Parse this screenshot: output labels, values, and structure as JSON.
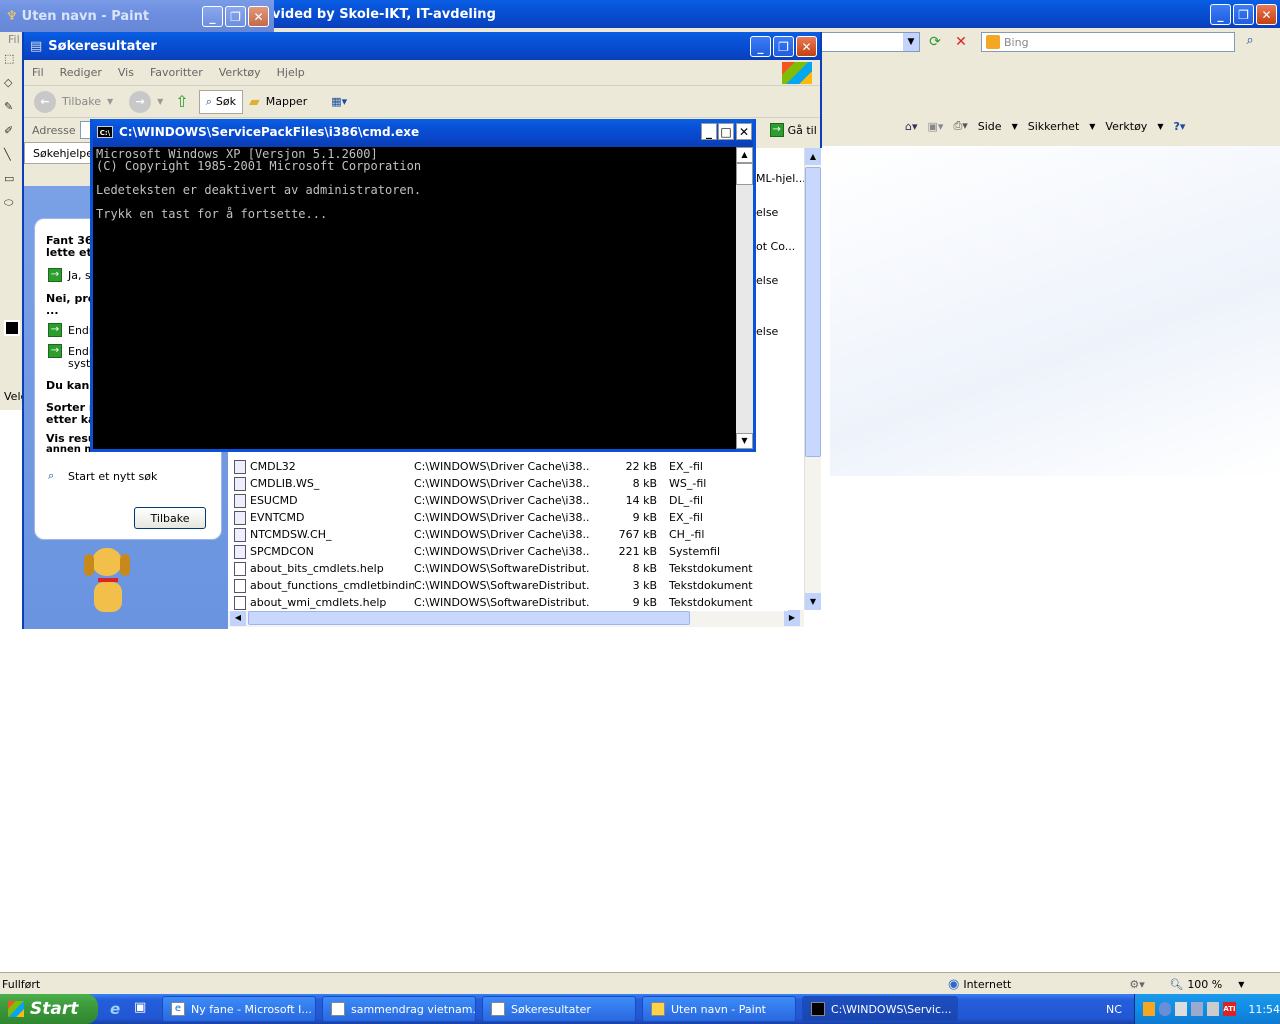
{
  "ie": {
    "title_suffix": "vided by Skole-IKT, IT-avdeling",
    "search_placeholder": "Bing",
    "toolbar": [
      "Side",
      "Sikkerhet",
      "Verktøy"
    ],
    "status_left": "Fullført",
    "status_zone": "Internett",
    "zoom": "100 %"
  },
  "paint": {
    "title": "Uten navn - Paint",
    "menu_fragment": "Fil",
    "status_fragment": "Velg"
  },
  "search": {
    "title": "Søkeresultater",
    "menu": [
      "Fil",
      "Rediger",
      "Vis",
      "Favoritter",
      "Verktøy",
      "Hjelp"
    ],
    "back": "Tilbake",
    "search": "Søk",
    "folders": "Mapper",
    "address_label": "Adresse",
    "go": "Gå til",
    "companion_tab": "Søkehjelper",
    "pane": {
      "found_1": "Fant 36",
      "found_2": "lette et",
      "yes": "Ja, s",
      "no": "Nei, pre",
      "dots": "...",
      "change1": "Endr",
      "change2a": "Endr",
      "change2b": "syst",
      "can": "Du kan",
      "sort_1": "Sorter r",
      "sort_2": "etter ka",
      "show_1": "Vis resu",
      "show_2": "annen måte",
      "new_search": "Start et nytt søk",
      "back_button": "Tilbake"
    },
    "partial_types": [
      "ML-hjel...",
      "else",
      "ot Co...",
      "else",
      "else"
    ],
    "rows": [
      {
        "name": "CMDL32",
        "path": "C:\\WINDOWS\\Driver Cache\\i38...",
        "size": "22 kB",
        "type": "EX_-fil"
      },
      {
        "name": "CMDLIB.WS_",
        "path": "C:\\WINDOWS\\Driver Cache\\i38...",
        "size": "8 kB",
        "type": "WS_-fil"
      },
      {
        "name": "ESUCMD",
        "path": "C:\\WINDOWS\\Driver Cache\\i38...",
        "size": "14 kB",
        "type": "DL_-fil"
      },
      {
        "name": "EVNTCMD",
        "path": "C:\\WINDOWS\\Driver Cache\\i38...",
        "size": "9 kB",
        "type": "EX_-fil"
      },
      {
        "name": "NTCMDSW.CH_",
        "path": "C:\\WINDOWS\\Driver Cache\\i38...",
        "size": "767 kB",
        "type": "CH_-fil"
      },
      {
        "name": "SPCMDCON",
        "path": "C:\\WINDOWS\\Driver Cache\\i38...",
        "size": "221 kB",
        "type": "Systemfil"
      },
      {
        "name": "about_bits_cmdlets.help",
        "path": "C:\\WINDOWS\\SoftwareDistribut...",
        "size": "8 kB",
        "type": "Tekstdokument"
      },
      {
        "name": "about_functions_cmdletbindin...",
        "path": "C:\\WINDOWS\\SoftwareDistribut...",
        "size": "3 kB",
        "type": "Tekstdokument"
      },
      {
        "name": "about_wmi_cmdlets.help",
        "path": "C:\\WINDOWS\\SoftwareDistribut...",
        "size": "9 kB",
        "type": "Tekstdokument"
      }
    ]
  },
  "cmd": {
    "title": "C:\\WINDOWS\\ServicePackFiles\\i386\\cmd.exe",
    "line1": "Microsoft Windows XP [Versjon 5.1.2600]",
    "line2": "(C) Copyright 1985-2001 Microsoft Corporation",
    "line3": "Ledeteksten er deaktivert av administratoren.",
    "line4": "Trykk en tast for å fortsette..."
  },
  "taskbar": {
    "start": "Start",
    "items": [
      "Ny fane - Microsoft I...",
      "sammendrag vietnam...",
      "Søkeresultater",
      "Uten navn - Paint",
      "C:\\WINDOWS\\Servic..."
    ],
    "lang": "NC",
    "time": "11:54"
  }
}
